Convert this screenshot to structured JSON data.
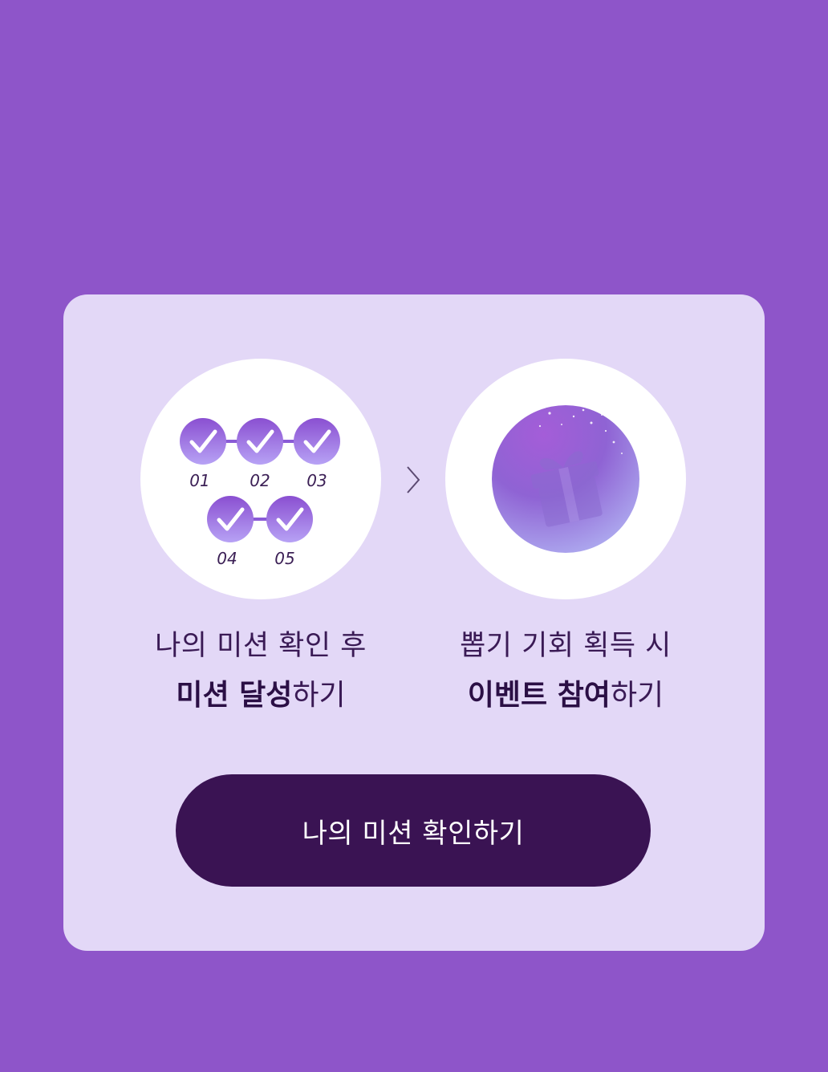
{
  "steps": [
    {
      "line1": "나의 미션 확인 후",
      "line2_bold": "미션 달성",
      "line2_rest": "하기",
      "checks": [
        "01",
        "02",
        "03",
        "04",
        "05"
      ],
      "icon": "mission-checklist-icon"
    },
    {
      "line1": "뽑기 기회 획득 시",
      "line2_bold": "이벤트 참여",
      "line2_rest": "하기",
      "icon": "gift-orb-icon"
    }
  ],
  "arrow_icon": "chevron-right-icon",
  "cta": {
    "label": "나의 미션 확인하기"
  },
  "colors": {
    "background": "#8e55c9",
    "card": "#e3d8f7",
    "button": "#3a1353",
    "text": "#3a1a55"
  }
}
